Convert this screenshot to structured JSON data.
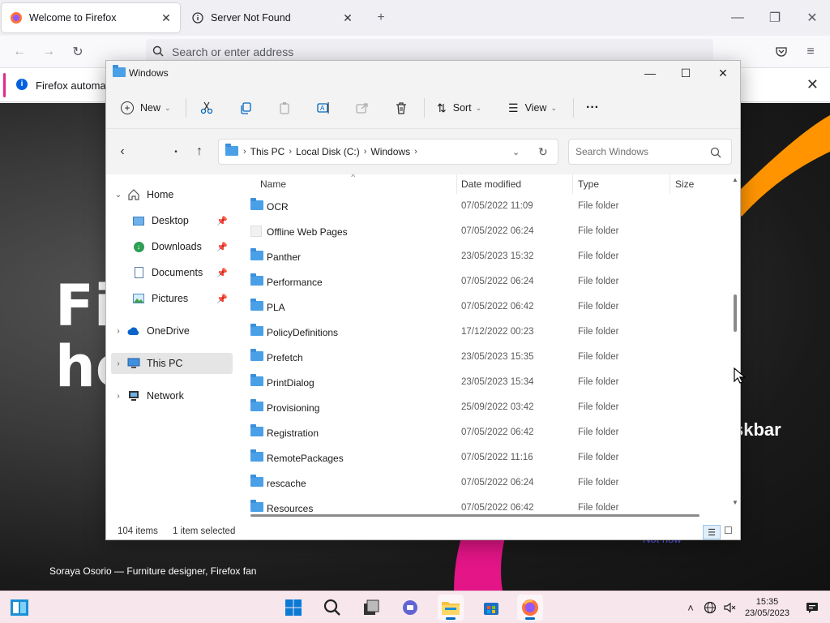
{
  "browser": {
    "tabs": [
      {
        "label": "Welcome to Firefox",
        "active": true
      },
      {
        "label": "Server Not Found",
        "active": false
      }
    ],
    "url_placeholder": "Search or enter address",
    "notification": "Firefox automati"
  },
  "webpage": {
    "hero_line1": "Fi",
    "hero_line2": "he",
    "side_text": "skbar",
    "caption": "Soraya Osorio — Furniture designer, Firefox fan",
    "not_now": "Not now"
  },
  "explorer": {
    "title": "Windows",
    "toolbar": {
      "new": "New",
      "sort": "Sort",
      "view": "View",
      "more": "···"
    },
    "breadcrumb": [
      "This PC",
      "Local Disk (C:)",
      "Windows"
    ],
    "search_placeholder": "Search Windows",
    "nav": [
      {
        "label": "Home",
        "icon": "home-icon"
      },
      {
        "label": "Desktop",
        "icon": "desktop-icon",
        "pinned": true
      },
      {
        "label": "Downloads",
        "icon": "download-icon",
        "pinned": true
      },
      {
        "label": "Documents",
        "icon": "document-icon",
        "pinned": true
      },
      {
        "label": "Pictures",
        "icon": "picture-icon",
        "pinned": true
      },
      {
        "label": "OneDrive",
        "icon": "cloud-icon"
      },
      {
        "label": "This PC",
        "icon": "computer-icon",
        "selected": true
      },
      {
        "label": "Network",
        "icon": "network-icon"
      }
    ],
    "columns": [
      "Name",
      "Date modified",
      "Type",
      "Size"
    ],
    "files": [
      {
        "name": "OCR",
        "date": "07/05/2022 11:09",
        "type": "File folder"
      },
      {
        "name": "Offline Web Pages",
        "date": "07/05/2022 06:24",
        "type": "File folder"
      },
      {
        "name": "Panther",
        "date": "23/05/2023 15:32",
        "type": "File folder"
      },
      {
        "name": "Performance",
        "date": "07/05/2022 06:24",
        "type": "File folder"
      },
      {
        "name": "PLA",
        "date": "07/05/2022 06:42",
        "type": "File folder"
      },
      {
        "name": "PolicyDefinitions",
        "date": "17/12/2022 00:23",
        "type": "File folder"
      },
      {
        "name": "Prefetch",
        "date": "23/05/2023 15:35",
        "type": "File folder"
      },
      {
        "name": "PrintDialog",
        "date": "23/05/2023 15:34",
        "type": "File folder"
      },
      {
        "name": "Provisioning",
        "date": "25/09/2022 03:42",
        "type": "File folder"
      },
      {
        "name": "Registration",
        "date": "07/05/2022 06:42",
        "type": "File folder"
      },
      {
        "name": "RemotePackages",
        "date": "07/05/2022 11:16",
        "type": "File folder"
      },
      {
        "name": "rescache",
        "date": "07/05/2022 06:24",
        "type": "File folder"
      },
      {
        "name": "Resources",
        "date": "07/05/2022 06:42",
        "type": "File folder"
      }
    ],
    "status": {
      "items": "104 items",
      "selected": "1 item selected"
    }
  },
  "taskbar": {
    "time": "15:35",
    "date": "23/05/2023"
  },
  "colors": {
    "folder": "#4aa0e6",
    "accent": "#0067c0",
    "taskbar_bg": "#f7e6ec"
  }
}
